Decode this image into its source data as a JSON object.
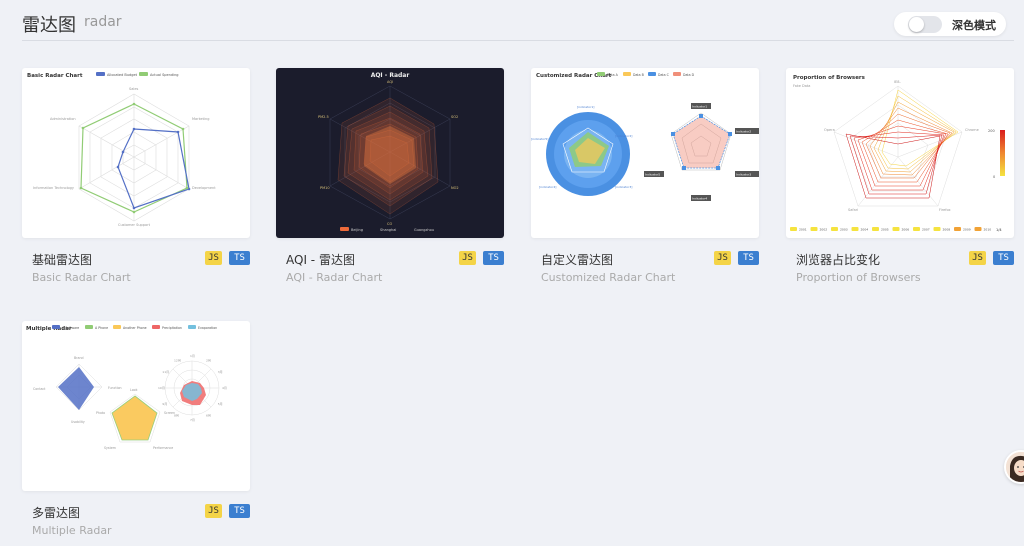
{
  "header": {
    "title": "雷达图",
    "subtitle": "radar",
    "dark_mode_label": "深色模式"
  },
  "cards": [
    {
      "title": "基础雷达图",
      "subtitle": "Basic Radar Chart",
      "js": "JS",
      "ts": "TS",
      "preview": {
        "title": "Basic Radar Chart",
        "legend": [
          "Allocated Budget",
          "Actual Spending"
        ],
        "indicators": [
          "Sales",
          "Marketing",
          "Development",
          "Customer Support",
          "Information Technology",
          "Administration"
        ]
      }
    },
    {
      "title": "AQI - 雷达图",
      "subtitle": "AQI - Radar Chart",
      "js": "JS",
      "ts": "TS",
      "preview": {
        "title": "AQI - Radar",
        "indicators": [
          "AQI",
          "SO2",
          "NO2",
          "CO",
          "PM10",
          "PM2.5"
        ],
        "legend": [
          "Beijing",
          "Shanghai",
          "Guangzhou"
        ]
      }
    },
    {
      "title": "自定义雷达图",
      "subtitle": "Customized Radar Chart",
      "js": "JS",
      "ts": "TS",
      "preview": {
        "title": "Customized Radar Chart",
        "legend": [
          "Data A",
          "Data B",
          "Data C",
          "Data D"
        ],
        "indicators": [
          "[indicator1]",
          "[indicator2]",
          "[indicator3]",
          "[indicator4]",
          "[indicator5]"
        ],
        "tags": [
          "Indicator1",
          "Indicator2",
          "Indicator3",
          "Indicator4",
          "Indicator5"
        ]
      }
    },
    {
      "title": "浏览器占比变化",
      "subtitle": "Proportion of Browsers",
      "js": "JS",
      "ts": "TS",
      "preview": {
        "title": "Proportion of Browsers",
        "subtitle": "Fake Data",
        "indicators": [
          "IE8-",
          "Chrome",
          "Firefox",
          "Safari",
          "Opera"
        ],
        "visual_max": "200",
        "visual_min": "0",
        "years": [
          "2001",
          "2002",
          "2003",
          "2004",
          "2005",
          "2006",
          "2007",
          "2008",
          "2009",
          "2010"
        ],
        "page": "1/4"
      }
    },
    {
      "title": "多雷达图",
      "subtitle": "Multiple Radar",
      "js": "JS",
      "ts": "TS",
      "preview": {
        "title": "Multiple Radar",
        "legend": [
          "A Software",
          "A Phone",
          "Another Phone",
          "Precipitation",
          "Evaporation"
        ],
        "indicators_a": [
          "Brand",
          "Function",
          "Contact",
          "Usability"
        ],
        "indicators_b": [
          "Look",
          "Photo",
          "System",
          "Performance",
          "Screen"
        ],
        "months": [
          "1月",
          "2月",
          "3月",
          "4月",
          "5月",
          "6月",
          "7月",
          "8月",
          "9月",
          "10月",
          "11月",
          "12月"
        ]
      }
    }
  ],
  "colors": {
    "js_badge": "#f4d447",
    "ts_badge": "#3b7fd0",
    "blue": "#5470c6",
    "green": "#91cc75",
    "yellow": "#fac858",
    "red": "#ee6666"
  }
}
